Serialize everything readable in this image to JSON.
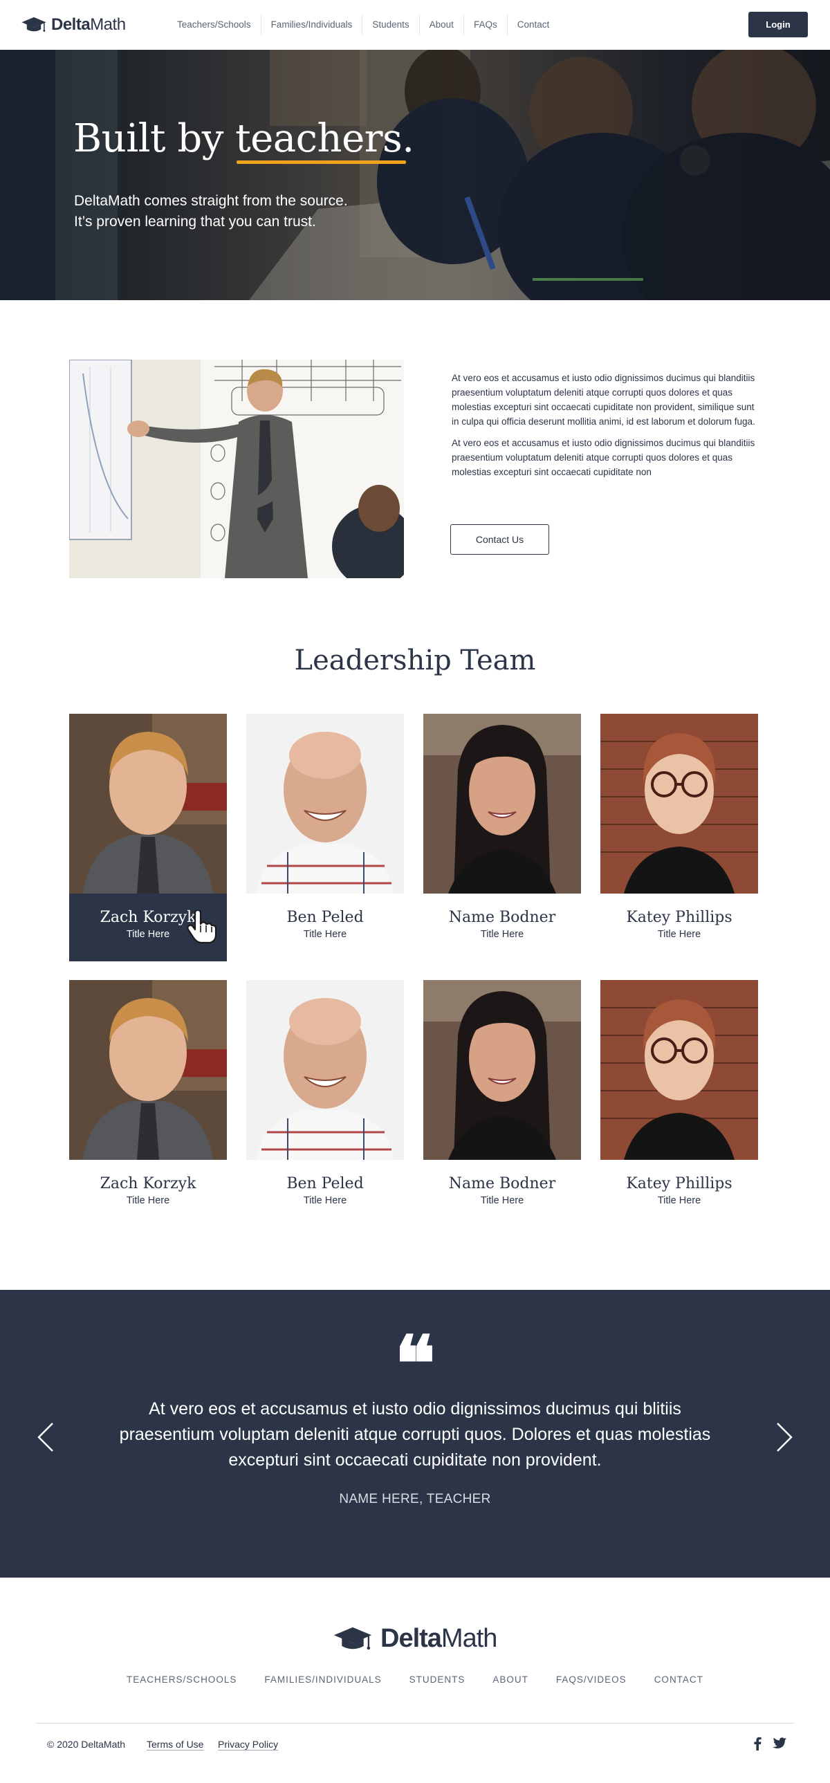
{
  "header": {
    "brand_bold": "Delta",
    "brand_rest": "Math",
    "nav": [
      "Teachers/Schools",
      "Families/Individuals",
      "Students",
      "About",
      "FAQs",
      "Contact"
    ],
    "login_label": "Login"
  },
  "hero": {
    "title_lead": "Built by ",
    "title_highlight": "teachers.",
    "subtitle_line1": "DeltaMath comes straight from the source.",
    "subtitle_line2": "It’s proven learning that you can trust."
  },
  "about": {
    "paragraph1": "At vero eos et accusamus et iusto odio dignissimos ducimus qui blanditiis praesentium voluptatum deleniti atque corrupti quos dolores et quas molestias excepturi sint occaecati cupiditate non provident, similique sunt in culpa qui officia deserunt mollitia animi, id est laborum et dolorum fuga.",
    "paragraph2": "At vero eos et accusamus et iusto odio dignissimos ducimus qui blanditiis praesentium voluptatum deleniti atque corrupti quos dolores et quas molestias excepturi sint occaecati cupiditate non",
    "contact_label": "Contact Us"
  },
  "leadership": {
    "title": "Leadership Team",
    "members": [
      {
        "name": "Zach Korzyk",
        "title": "Title Here"
      },
      {
        "name": "Ben Peled",
        "title": "Title Here"
      },
      {
        "name": "Name Bodner",
        "title": "Title Here"
      },
      {
        "name": "Katey Phillips",
        "title": "Title Here"
      },
      {
        "name": "Zach Korzyk",
        "title": "Title Here"
      },
      {
        "name": "Ben Peled",
        "title": "Title Here"
      },
      {
        "name": "Name Bodner",
        "title": "Title Here"
      },
      {
        "name": "Katey Phillips",
        "title": "Title Here"
      }
    ]
  },
  "testimonial": {
    "quote_mark": "❝",
    "text": "At vero eos et accusamus et iusto odio dignissimos ducimus qui blitiis praesentium voluptam deleniti atque corrupti quos. Dolores et quas molestias excepturi sint occaecati cupiditate non provident.",
    "author": "NAME HERE, TEACHER"
  },
  "footer": {
    "brand_bold": "Delta",
    "brand_rest": "Math",
    "nav": [
      "TEACHERS/SCHOOLS",
      "FAMILIES/INDIVIDUALS",
      "STUDENTS",
      "ABOUT",
      "FAQS/VIDEOS",
      "CONTACT"
    ],
    "copyright": "© 2020 DeltaMath",
    "terms": "Terms of Use",
    "privacy": "Privacy Policy"
  },
  "colors": {
    "navy": "#2b3547",
    "accent": "#f0a31a",
    "white": "#ffffff"
  },
  "icons": {
    "logo": "graduation-cap-icon",
    "quote": "quote-icon",
    "prev": "chevron-left-icon",
    "next": "chevron-right-icon",
    "cursor": "hand-pointer-icon",
    "social": [
      "facebook-icon",
      "twitter-icon"
    ]
  }
}
